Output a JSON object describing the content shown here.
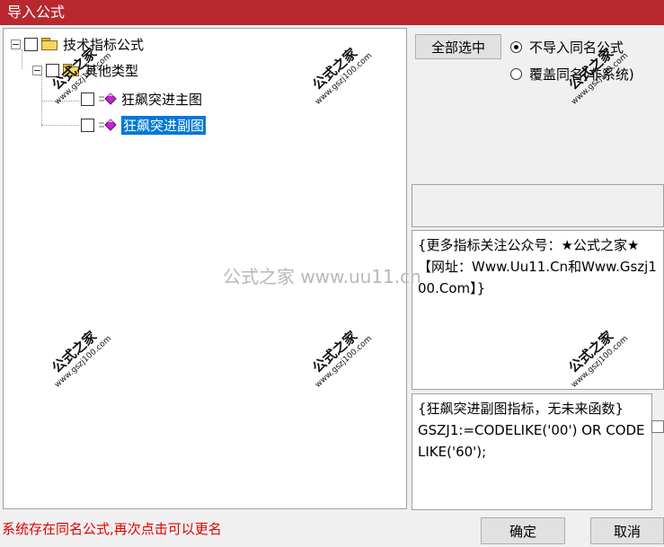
{
  "window": {
    "title": "导入公式"
  },
  "tree": {
    "root": {
      "label": "技术指标公式"
    },
    "group": {
      "label": "其他类型"
    },
    "items": [
      {
        "label": "狂飙突进主图",
        "selected": false
      },
      {
        "label": "狂飙突进副图",
        "selected": true
      }
    ]
  },
  "controls": {
    "select_all_label": "全部选中",
    "radio_no_import_label": "不导入同名公式",
    "radio_overwrite_label": "覆盖同名(非系统)"
  },
  "info_text": "{更多指标关注公众号：★公式之家★【网址：Www.Uu11.Cn和Www.Gszj100.Com】}",
  "formula_text": "{狂飙突进副图指标，无未来函数}\nGSZJ1:=CODELIKE('00') OR CODELIKE('60');",
  "status_text": "系统存在同名公式,再次点击可以更名",
  "buttons": {
    "ok_label": "确定",
    "cancel_label": "取消"
  },
  "watermark": {
    "center_text": "公式之家 www.uu11.cn",
    "stamp_text": "公式之家",
    "stamp_url": "www.gszj100.com"
  },
  "colors": {
    "titlebar": "#b8282e",
    "selection": "#0078d7",
    "status": "#e00000"
  }
}
